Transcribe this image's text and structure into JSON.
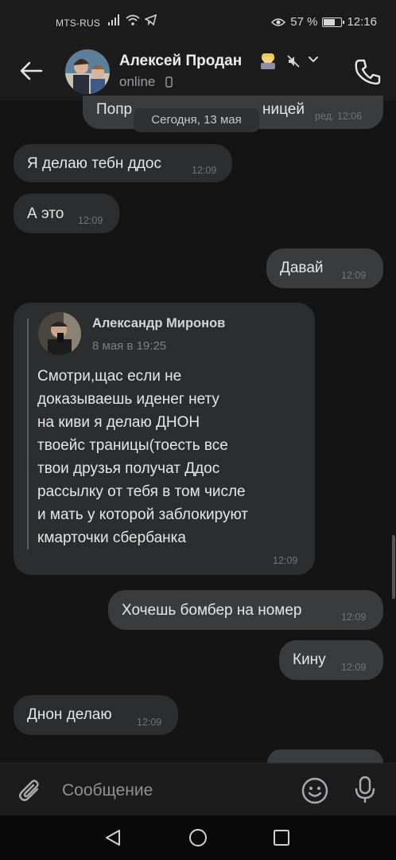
{
  "status_bar": {
    "carrier": "MTS-RUS",
    "battery_percent": "57 %",
    "battery_level": 0.57,
    "time": "12:16",
    "icons": [
      "signal-icon",
      "wifi-icon",
      "telegram-icon",
      "eye-icon",
      "battery-icon"
    ]
  },
  "header": {
    "contact_name": "Алексей Продан",
    "status": "online",
    "icons": [
      "back-arrow-icon",
      "avatar",
      "emoji-badge",
      "mute-icon",
      "chevron-down-icon",
      "phone-call-icon"
    ]
  },
  "chat": {
    "date_chip": "Сегодня, 13 мая",
    "messages": [
      {
        "dir": "out",
        "text": "Попрошу не мешать страницей",
        "visible_left": "Попр",
        "visible_right": "ницей",
        "time": "ред. 12:06"
      },
      {
        "dir": "in",
        "text": "Я делаю тебн ддос",
        "time": "12:09"
      },
      {
        "dir": "in",
        "text": "А это",
        "time": "12:09"
      },
      {
        "dir": "out",
        "text": "Давай",
        "time": "12:09"
      },
      {
        "dir": "in",
        "type": "forward",
        "time": "12:09"
      },
      {
        "dir": "out",
        "text": "Хочешь бомбер на номер",
        "time": "12:09"
      },
      {
        "dir": "out",
        "text": "Кину",
        "time": "12:09"
      },
      {
        "dir": "in",
        "text": "Днон делаю",
        "time": "12:09"
      }
    ],
    "forward": {
      "author": "Александр Миронов",
      "date": "8 мая в 19:25",
      "lines": [
        "Смотри,щас если не",
        "доказываешь иденег нету",
        "на киви я делаю ДНОН",
        "твоейс траницы(тоесть все",
        "твои друзья получат Ддос",
        "рассылку от тебя в том числе",
        "и мать у которой заблокируют",
        "кмарточки сбербанка"
      ]
    }
  },
  "composer": {
    "placeholder": "Сообщение",
    "icons": [
      "paperclip-icon",
      "emoji-icon",
      "microphone-icon"
    ]
  },
  "navbar": {
    "icons": [
      "nav-back-icon",
      "nav-home-icon",
      "nav-recent-icon"
    ]
  },
  "colors": {
    "background": "#141414",
    "bar": "#1c1c1c",
    "bubble_in": "#2c2d2e",
    "bubble_out": "#3a3b3d",
    "text": "#e6e6e6",
    "time": "#727477"
  }
}
